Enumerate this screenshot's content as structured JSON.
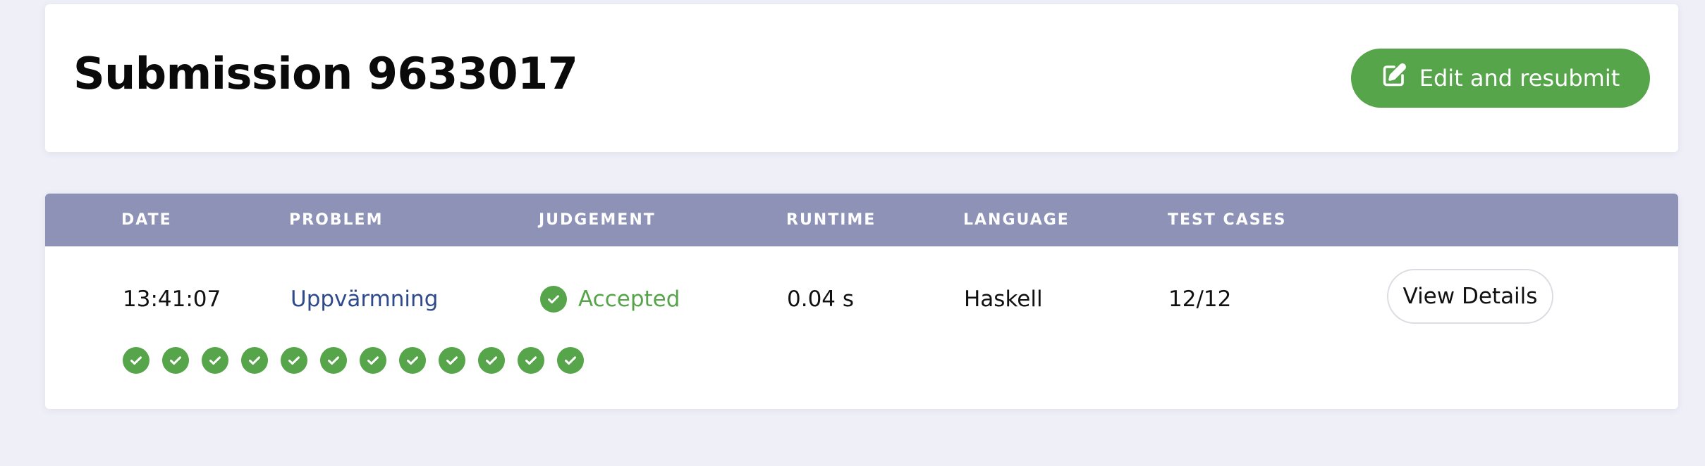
{
  "header": {
    "title": "Submission 9633017",
    "resubmit_label": "Edit and resubmit"
  },
  "table": {
    "columns": [
      "DATE",
      "PROBLEM",
      "JUDGEMENT",
      "RUNTIME",
      "LANGUAGE",
      "TEST CASES"
    ],
    "row": {
      "date": "13:41:07",
      "problem": "Uppvärmning",
      "judgement": "Accepted",
      "runtime": "0.04 s",
      "language": "Haskell",
      "test_cases": "12/12",
      "view_details_label": "View Details"
    },
    "test_case_results": [
      "accepted",
      "accepted",
      "accepted",
      "accepted",
      "accepted",
      "accepted",
      "accepted",
      "accepted",
      "accepted",
      "accepted",
      "accepted",
      "accepted"
    ]
  },
  "colors": {
    "accent_green": "#57a54a",
    "header_bar": "#8e92b7",
    "link": "#2e4a8c",
    "background": "#eeeff7"
  },
  "icons": {
    "resubmit": "edit-icon",
    "judgement": "check-circle-icon",
    "test_case": "check-circle-icon"
  }
}
